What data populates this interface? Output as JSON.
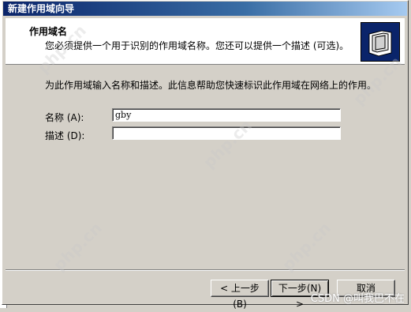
{
  "window": {
    "title": "新建作用域向导"
  },
  "header": {
    "title": "作用域名",
    "description": "您必须提供一个用于识别的作用域名称。您还可以提供一个描述 (可选)。",
    "icon": "folders-icon"
  },
  "body": {
    "instructions": "为此作用域输入名称和描述。此信息帮助您快速标识此作用域在网络上的作用。",
    "name_label": "名称 (A):",
    "name_value": "gby",
    "description_label": "描述 (D):",
    "description_value": ""
  },
  "buttons": {
    "back": "< 上一步(B)",
    "next": "下一步(N) >",
    "cancel": "取消"
  },
  "watermarks": [
    "php.cn",
    "php.cn",
    "php.cn",
    "php.cn",
    "php.cn"
  ],
  "footer_watermark": "CSDN @叫我巴不在"
}
